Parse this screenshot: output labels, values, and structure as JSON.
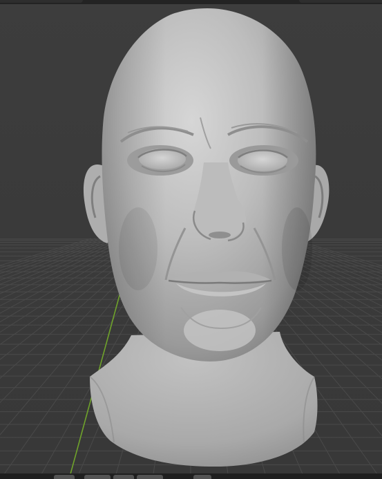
{
  "viewport": {
    "mode": "3D sculpt view",
    "subject": "head-sculpt",
    "background_color": "#3a3a3a",
    "grid_color": "#4a4a4a",
    "y_axis_color": "#6fa32b",
    "mesh_color": "#b9b9b9"
  },
  "header_widgets": [
    {
      "icon": "editor-tab-icon"
    },
    {
      "icon": "overlay-tab-icon"
    }
  ],
  "footer_widgets": [
    {
      "icon": "mode-button-icon"
    },
    {
      "icon": "view-button-icon"
    },
    {
      "icon": "select-button-icon"
    },
    {
      "icon": "add-button-icon"
    },
    {
      "icon": "object-button-icon"
    }
  ]
}
